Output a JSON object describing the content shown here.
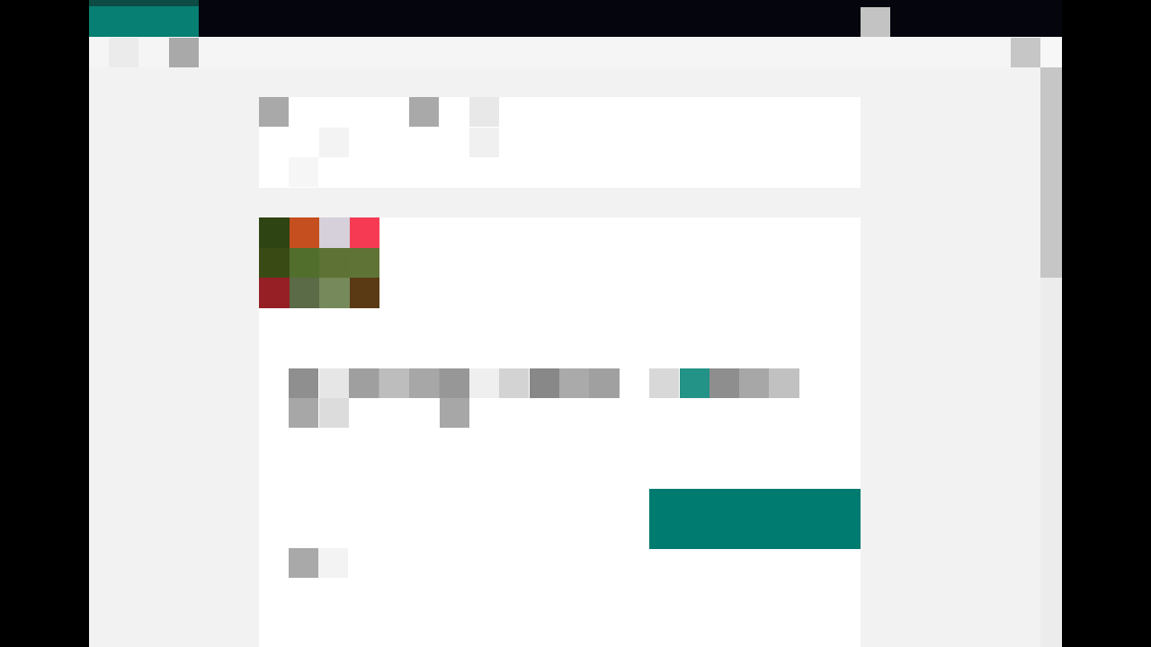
{
  "colors": {
    "accent": "#087f73",
    "accent_dark": "#0c4c45",
    "primary_button": "#007b70",
    "titlebar": "#05060d",
    "background": "#f2f2f2",
    "card": "#ffffff"
  },
  "titlebar": {
    "app_tab_label": "",
    "window_button_icon": "restore-icon"
  },
  "toolbar": {
    "back_icon": "back-arrow-icon",
    "menu_icon": "hamburger-menu-icon",
    "right_icon": "account-icon",
    "close_icon": "close-icon"
  },
  "header_card": {
    "title": "",
    "subtitle": "",
    "detail": ""
  },
  "main_card": {
    "thumbnail_colors": [
      "#2e4413",
      "#c64f20",
      "#d5d0d9",
      "#f73a53",
      "#3a4a14",
      "#516e2d",
      "#5d7234",
      "#607337",
      "#951f25",
      "#5b6a47",
      "#76895a",
      "#5a3a14"
    ],
    "item_title": "",
    "item_link": "",
    "item_meta": "",
    "price": "",
    "primary_button_label": "",
    "secondary_link": ""
  }
}
